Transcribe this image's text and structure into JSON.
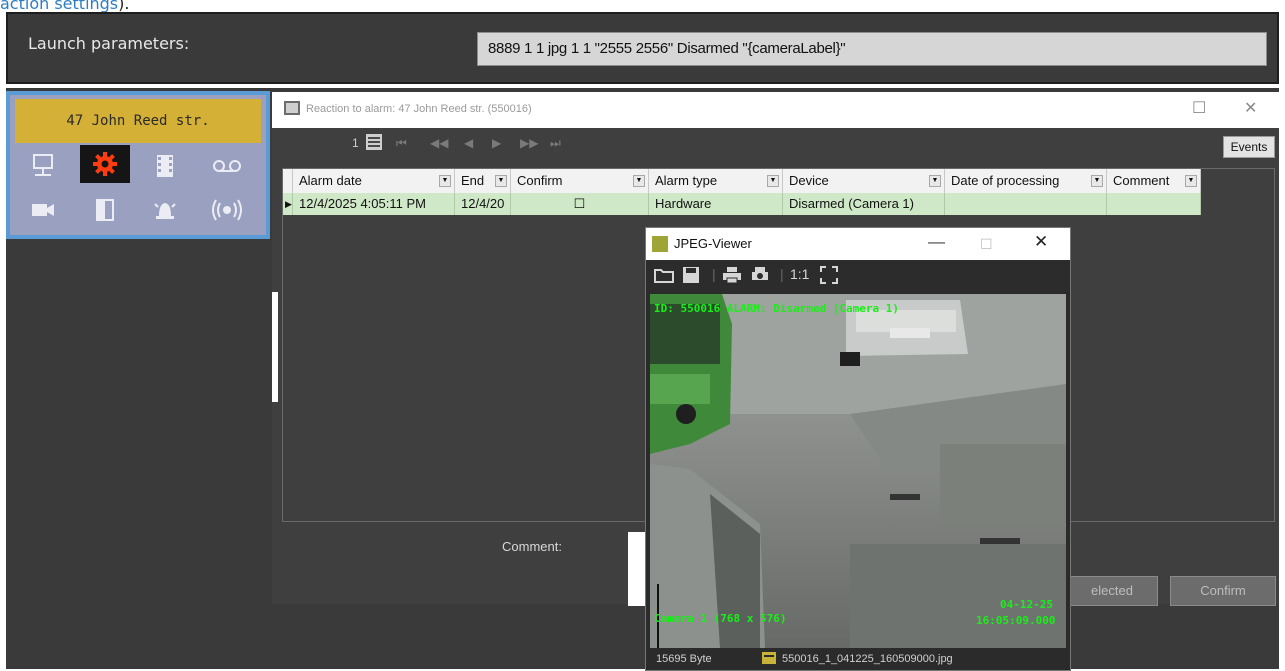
{
  "breadcrumb": {
    "link": "action settings",
    "trail": ")."
  },
  "launch": {
    "label": "Launch parameters:",
    "value": "8889 1 1 jpg 1 1 \"2555 2556\" Disarmed \"{cameraLabel}\""
  },
  "panel": {
    "site_label": "47 John Reed str.",
    "icons": [
      "network-icon",
      "settings-gear-icon",
      "film-icon",
      "voicemail-icon",
      "camera-icon",
      "door-icon",
      "alarm-bell-icon",
      "radio-signal-icon"
    ]
  },
  "alarm_window": {
    "title": "Reaction to alarm: 47 John Reed str. (550016)",
    "page_number": "1",
    "events_label": "Events",
    "columns": [
      "Alarm date",
      "End",
      "Confirm",
      "Alarm type",
      "Device",
      "Date of processing",
      "Comment"
    ],
    "rows": [
      {
        "alarm_date": "12/4/2025 4:05:11 PM",
        "end": "12/4/20",
        "confirm": "☐",
        "alarm_type": "Hardware",
        "device": "Disarmed (Camera 1)",
        "date_of_processing": "",
        "comment": ""
      }
    ],
    "comment_label": "Comment:",
    "selected_label": "elected",
    "confirm_label": "Confirm"
  },
  "viewer": {
    "title": "JPEG-Viewer",
    "zoom_label": "1:1",
    "overlay_top": "ID: 550016  ALARM: Disarmed (Camera 1)",
    "overlay_camera": "Camera 1 (768 x 576)",
    "overlay_date": "04-12-25",
    "overlay_time": "16:05:09.000",
    "file_size": "15695 Byte",
    "file_name": "550016_1_041225_160509000.jpg"
  }
}
